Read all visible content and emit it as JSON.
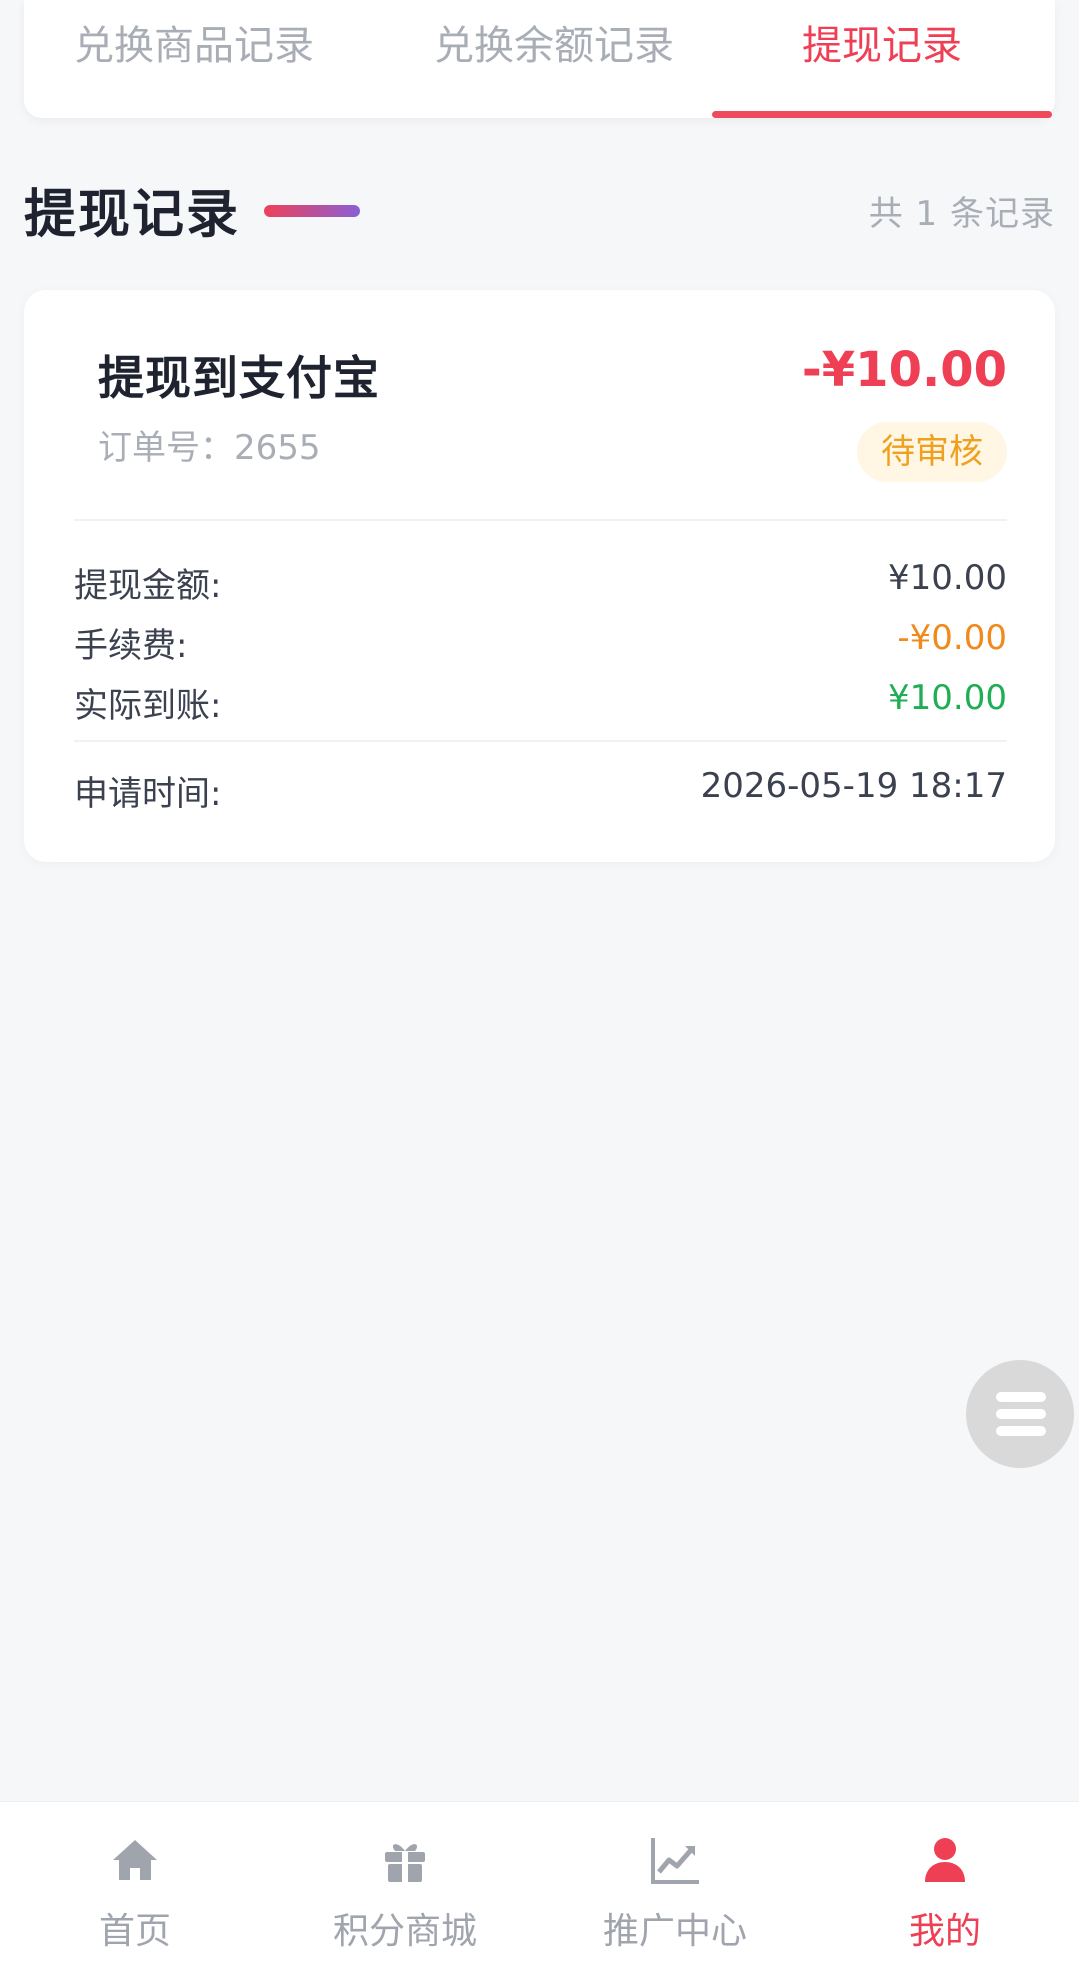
{
  "tabs": [
    {
      "label": "兑换商品记录",
      "active": false
    },
    {
      "label": "兑换余额记录",
      "active": false
    },
    {
      "label": "提现记录",
      "active": true
    }
  ],
  "section": {
    "title": "提现记录",
    "count_text": "共 1 条记录"
  },
  "record": {
    "title": "提现到支付宝",
    "order_no": "订单号：2655",
    "amount": "-¥10.00",
    "status": "待审核",
    "rows": [
      {
        "label": "提现金额:",
        "value": "¥10.00"
      },
      {
        "label": "手续费:",
        "value": "-¥0.00"
      },
      {
        "label": "实际到账:",
        "value": "¥10.00"
      },
      {
        "label": "申请时间:",
        "value": "2026-05-19 18:17"
      }
    ]
  },
  "floating_button": {
    "icon": "menu-icon"
  },
  "bottom_nav": [
    {
      "label": "首页",
      "icon": "home-icon",
      "active": false
    },
    {
      "label": "积分商城",
      "icon": "gift-icon",
      "active": false
    },
    {
      "label": "推广中心",
      "icon": "chart-icon",
      "active": false
    },
    {
      "label": "我的",
      "icon": "user-icon",
      "active": true
    }
  ],
  "colors": {
    "accent": "#ee3f55",
    "inactive": "#a0a4ad",
    "pending": "#f0a020",
    "fee": "#f08a1c",
    "credited": "#1fae55",
    "background": "#f6f7f9"
  }
}
